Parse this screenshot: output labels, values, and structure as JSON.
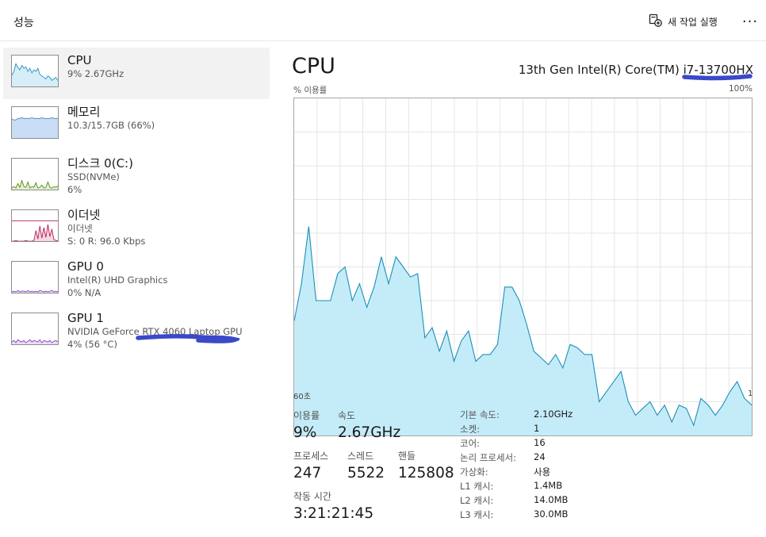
{
  "header": {
    "title": "성능",
    "new_task_label": "새 작업 실행",
    "more_label": "···"
  },
  "sidebar": {
    "items": [
      {
        "name": "CPU",
        "line1": "9% 2.67GHz",
        "line2": "",
        "color": "#1a8fb8",
        "fill": "#d6eef7"
      },
      {
        "name": "메모리",
        "line1": "10.3/15.7GB (66%)",
        "line2": "",
        "color": "#4b82c4",
        "fill": "#c9ddf5"
      },
      {
        "name": "디스크 0(C:)",
        "line1": "SSD(NVMe)",
        "line2": "6%",
        "color": "#4d8a0f",
        "fill": "#e3efd2"
      },
      {
        "name": "이더넷",
        "line1": "이더넷",
        "line2": "S: 0 R: 96.0 Kbps",
        "color": "#b01853",
        "fill": "#f5d6e3"
      },
      {
        "name": "GPU 0",
        "line1": "Intel(R) UHD Graphics",
        "line2": "0% N/A",
        "color": "#7b3bbf",
        "fill": "#eadcf7"
      },
      {
        "name": "GPU 1",
        "line1": "NVIDIA GeForce RTX 4060 Laptop GPU",
        "line2": "4% (56 °C)",
        "color": "#7b3bbf",
        "fill": "#eadcf7"
      }
    ]
  },
  "main": {
    "title": "CPU",
    "model": "13th Gen Intel(R) Core(TM) i7-13700HX",
    "util_label": "% 이용률",
    "max_label": "100%",
    "time_left": "60초",
    "time_right": "1",
    "stats": {
      "utilization_label": "이용률",
      "utilization_value": "9%",
      "speed_label": "속도",
      "speed_value": "2.67GHz",
      "processes_label": "프로세스",
      "processes_value": "247",
      "threads_label": "스레드",
      "threads_value": "5522",
      "handles_label": "핸들",
      "handles_value": "125808",
      "uptime_label": "작동 시간",
      "uptime_value": "3:21:21:45"
    },
    "specs": [
      {
        "label": "기본 속도:",
        "value": "2.10GHz"
      },
      {
        "label": "소켓:",
        "value": "1"
      },
      {
        "label": "코어:",
        "value": "16"
      },
      {
        "label": "논리 프로세서:",
        "value": "24"
      },
      {
        "label": "가상화:",
        "value": "사용"
      },
      {
        "label": "L1 캐시:",
        "value": "1.4MB"
      },
      {
        "label": "L2 캐시:",
        "value": "14.0MB"
      },
      {
        "label": "L3 캐시:",
        "value": "30.0MB"
      }
    ]
  },
  "chart_data": {
    "type": "area",
    "title": "CPU",
    "ylabel": "% 이용률",
    "ylim": [
      0,
      100
    ],
    "x_range_label": [
      "60초",
      "1"
    ],
    "grid": true,
    "values": [
      34,
      45,
      62,
      40,
      40,
      40,
      48,
      50,
      40,
      45,
      38,
      44,
      53,
      45,
      53,
      50,
      47,
      48,
      29,
      32,
      25,
      31,
      22,
      28,
      31,
      22,
      24,
      24,
      27,
      44,
      44,
      40,
      33,
      25,
      23,
      21,
      24,
      20,
      27,
      26,
      24,
      24,
      10,
      13,
      16,
      19,
      10,
      6,
      8,
      10,
      6,
      9,
      4,
      9,
      8,
      3,
      11,
      9,
      6,
      9,
      13,
      16,
      11,
      9
    ]
  }
}
